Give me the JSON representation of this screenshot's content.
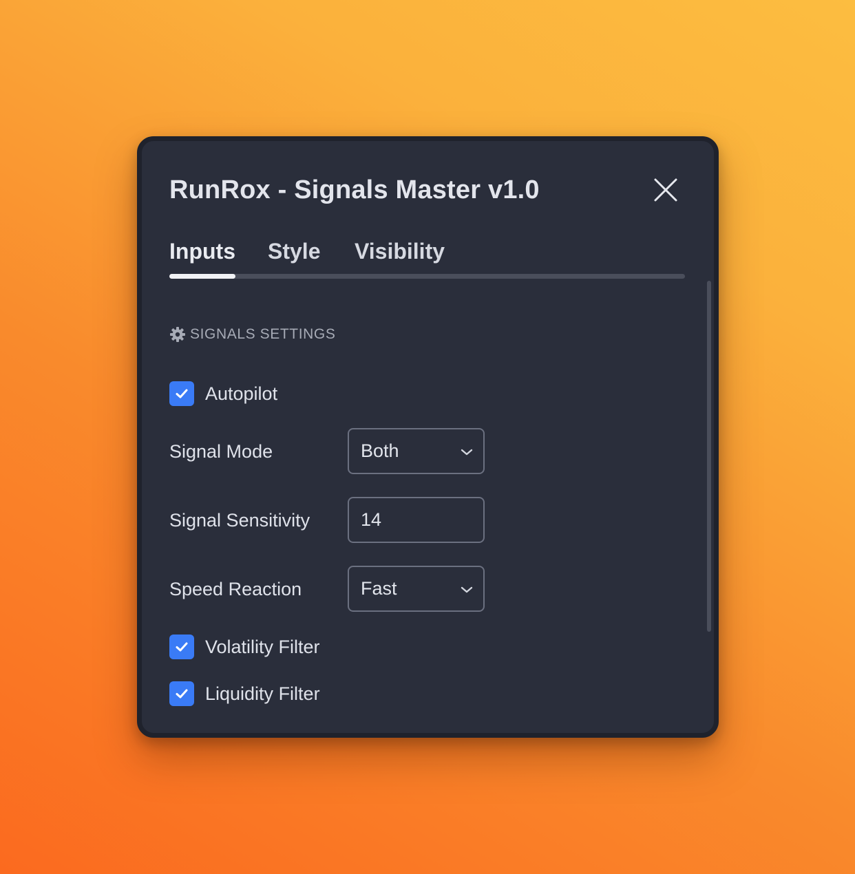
{
  "dialog": {
    "title": "RunRox - Signals Master v1.0",
    "close_icon": "close-icon"
  },
  "tabs": [
    {
      "label": "Inputs",
      "active": true
    },
    {
      "label": "Style",
      "active": false
    },
    {
      "label": "Visibility",
      "active": false
    }
  ],
  "section": {
    "icon": "gear-icon",
    "label": "SIGNALS SETTINGS"
  },
  "settings": {
    "autopilot": {
      "label": "Autopilot",
      "checked": true
    },
    "signal_mode": {
      "label": "Signal Mode",
      "value": "Both"
    },
    "signal_sensitivity": {
      "label": "Signal Sensitivity",
      "value": "14"
    },
    "speed_reaction": {
      "label": "Speed Reaction",
      "value": "Fast"
    },
    "volatility_filter": {
      "label": "Volatility Filter",
      "checked": true
    },
    "liquidity_filter": {
      "label": "Liquidity Filter",
      "checked": true
    }
  },
  "colors": {
    "accent": "#3a7bf6",
    "panel": "#2a2e3b",
    "text": "#dfe2ea",
    "muted": "#a7abb6"
  }
}
